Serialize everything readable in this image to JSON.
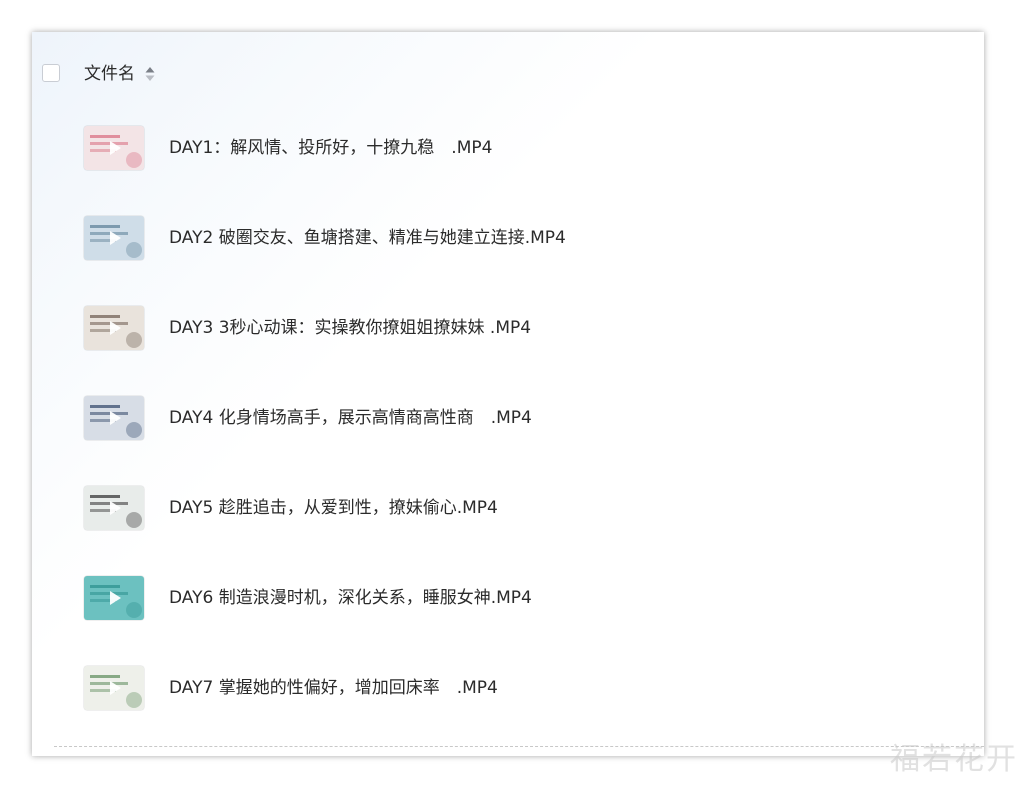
{
  "header": {
    "column_title": "文件名"
  },
  "files": [
    {
      "name": "DAY1：解风情、投所好，十撩九稳　.MP4",
      "thumb_colors": [
        "#f3e4e6",
        "#d76a7d"
      ]
    },
    {
      "name": "DAY2 破圈交友、鱼塘搭建、精准与她建立连接.MP4",
      "thumb_colors": [
        "#cfdde8",
        "#5a7e95"
      ]
    },
    {
      "name": "DAY3 3秒心动课：实操教你撩姐姐撩妹妹 .MP4",
      "thumb_colors": [
        "#e9e3dc",
        "#6b5a4e"
      ]
    },
    {
      "name": "DAY4 化身情场高手，展示高情商高性商　.MP4",
      "thumb_colors": [
        "#d7dde6",
        "#2f4466"
      ]
    },
    {
      "name": "DAY5 趁胜追击，从爱到性，撩妹偷心.MP4",
      "thumb_colors": [
        "#e8ecea",
        "#2e2e2e"
      ]
    },
    {
      "name": "DAY6 制造浪漫时机，深化关系，睡服女神.MP4",
      "thumb_colors": [
        "#6cc1c0",
        "#2b8f8d"
      ]
    },
    {
      "name": "DAY7 掌握她的性偏好，增加回床率　.MP4",
      "thumb_colors": [
        "#eef0ea",
        "#5b8a5a"
      ]
    }
  ],
  "watermark": "福若花开"
}
